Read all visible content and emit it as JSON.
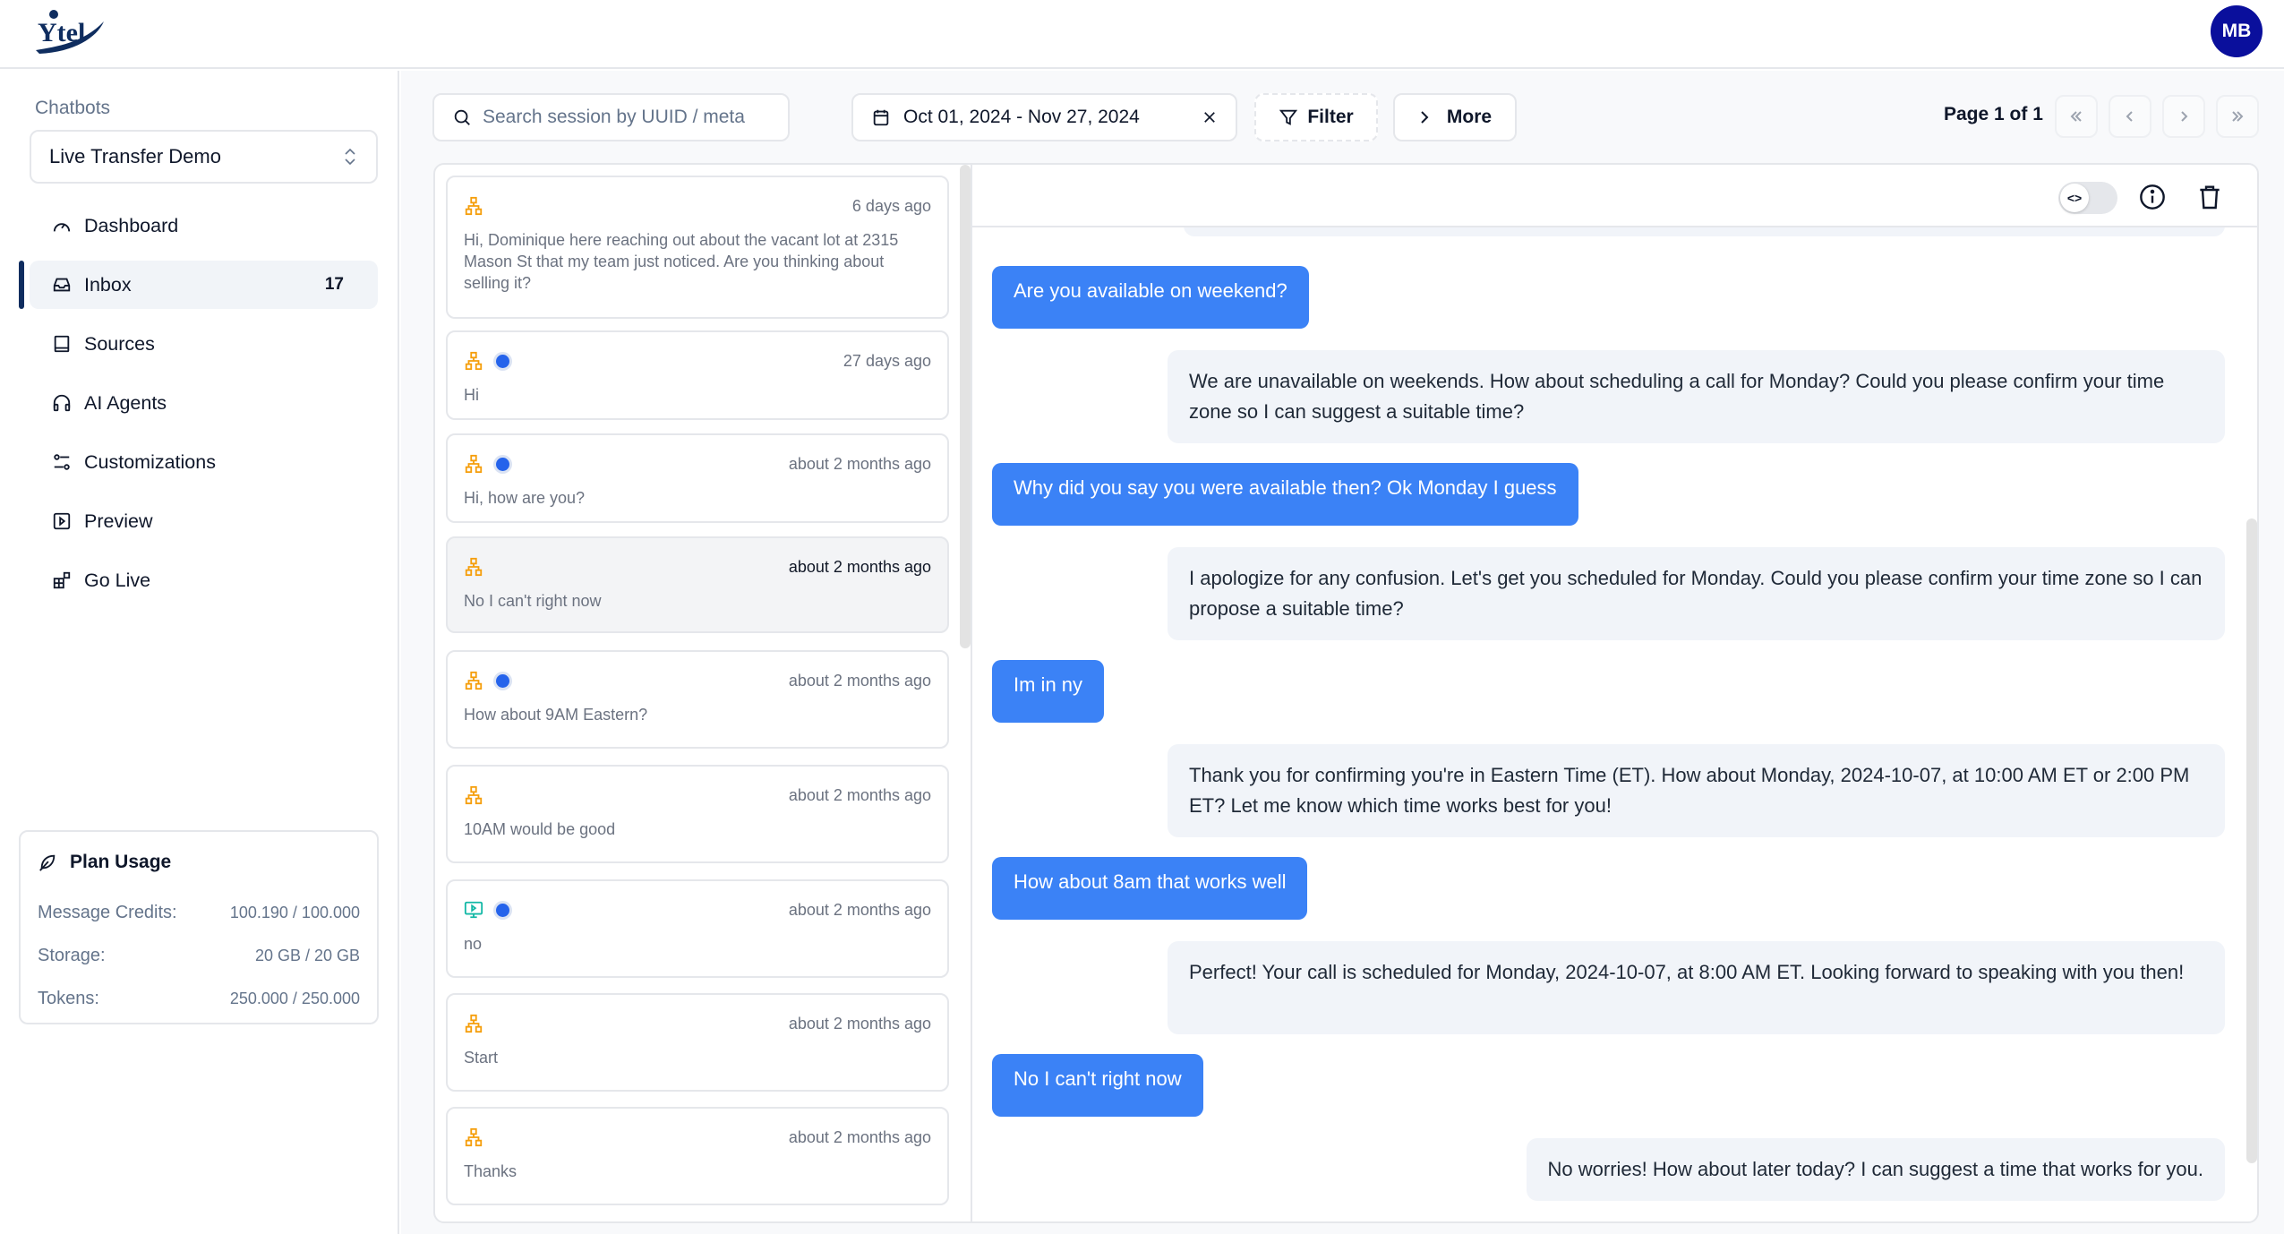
{
  "header": {
    "logo_text": "Ytel",
    "avatar_initials": "MB",
    "brand_color": "#0f2d5f",
    "avatar_color": "#0a0f9c"
  },
  "sidebar": {
    "section_label": "Chatbots",
    "selected_chatbot": "Live Transfer Demo",
    "items": [
      {
        "label": "Dashboard",
        "icon": "gauge-icon"
      },
      {
        "label": "Inbox",
        "icon": "inbox-icon",
        "badge": "17",
        "active": true
      },
      {
        "label": "Sources",
        "icon": "book-icon"
      },
      {
        "label": "AI Agents",
        "icon": "headphones-icon"
      },
      {
        "label": "Customizations",
        "icon": "sliders-icon"
      },
      {
        "label": "Preview",
        "icon": "play-square-icon"
      },
      {
        "label": "Go Live",
        "icon": "blocks-icon"
      }
    ],
    "plan_usage": {
      "title": "Plan Usage",
      "rows": [
        {
          "label": "Message Credits:",
          "value": "100.190 / 100.000"
        },
        {
          "label": "Storage:",
          "value": "20 GB / 20 GB"
        },
        {
          "label": "Tokens:",
          "value": "250.000 / 250.000"
        }
      ]
    }
  },
  "toolbar": {
    "search_placeholder": "Search session by UUID / meta",
    "search_value": "",
    "date_range": "Oct 01, 2024 - Nov 27, 2024",
    "filter_label": "Filter",
    "more_label": "More",
    "page_label": "Page 1 of 1"
  },
  "sessions": [
    {
      "source": "workflow",
      "unread": false,
      "time": "6 days ago",
      "preview": "Hi, Dominique here reaching out about the vacant lot at 2315 Mason St that my team just noticed. Are you thinking about selling it?"
    },
    {
      "source": "workflow",
      "unread": true,
      "time": "27 days ago",
      "preview": "Hi"
    },
    {
      "source": "workflow",
      "unread": true,
      "time": "about 2 months ago",
      "preview": "Hi, how are you?"
    },
    {
      "source": "workflow",
      "unread": false,
      "time": "about 2 months ago",
      "preview": "No I can't right now",
      "selected": true
    },
    {
      "source": "workflow",
      "unread": true,
      "time": "about 2 months ago",
      "preview": "How about 9AM Eastern?"
    },
    {
      "source": "workflow",
      "unread": false,
      "time": "about 2 months ago",
      "preview": "10AM would be good"
    },
    {
      "source": "preview",
      "unread": true,
      "time": "about 2 months ago",
      "preview": "no"
    },
    {
      "source": "workflow",
      "unread": false,
      "time": "about 2 months ago",
      "preview": "Start"
    },
    {
      "source": "workflow",
      "unread": false,
      "time": "about 2 months ago",
      "preview": "Thanks"
    }
  ],
  "chat": {
    "toggle_glyph": "<>",
    "messages": [
      {
        "role": "user",
        "text": "Are you available on weekend?"
      },
      {
        "role": "bot",
        "text": "We are unavailable on weekends. How about scheduling a call for Monday? Could you please confirm your time zone so I can suggest a suitable time?"
      },
      {
        "role": "user",
        "text": "Why did you say you were available then?  Ok Monday I guess"
      },
      {
        "role": "bot",
        "text": "I apologize for any confusion. Let's get you scheduled for Monday. Could you please confirm your time zone so I can propose a suitable time?"
      },
      {
        "role": "user",
        "text": "Im in ny"
      },
      {
        "role": "bot",
        "text": "Thank you for confirming you're in Eastern Time (ET). How about Monday, 2024-10-07, at 10:00 AM ET or 2:00 PM ET? Let me know which time works best for you!"
      },
      {
        "role": "user",
        "text": "How about 8am that works well"
      },
      {
        "role": "bot",
        "text": "Perfect! Your call is scheduled for Monday, 2024-10-07, at 8:00 AM ET. Looking forward to speaking with you then!"
      },
      {
        "role": "user",
        "text": "No I can't right now"
      },
      {
        "role": "bot",
        "text": "No worries! How about later today? I can suggest a time that works for you."
      }
    ]
  },
  "colors": {
    "user_bubble": "#3b82f6",
    "bot_bubble": "#f1f4f9",
    "workflow_icon": "#f59e0b",
    "preview_icon": "#14b8a6",
    "unread_dot": "#2563eb"
  }
}
